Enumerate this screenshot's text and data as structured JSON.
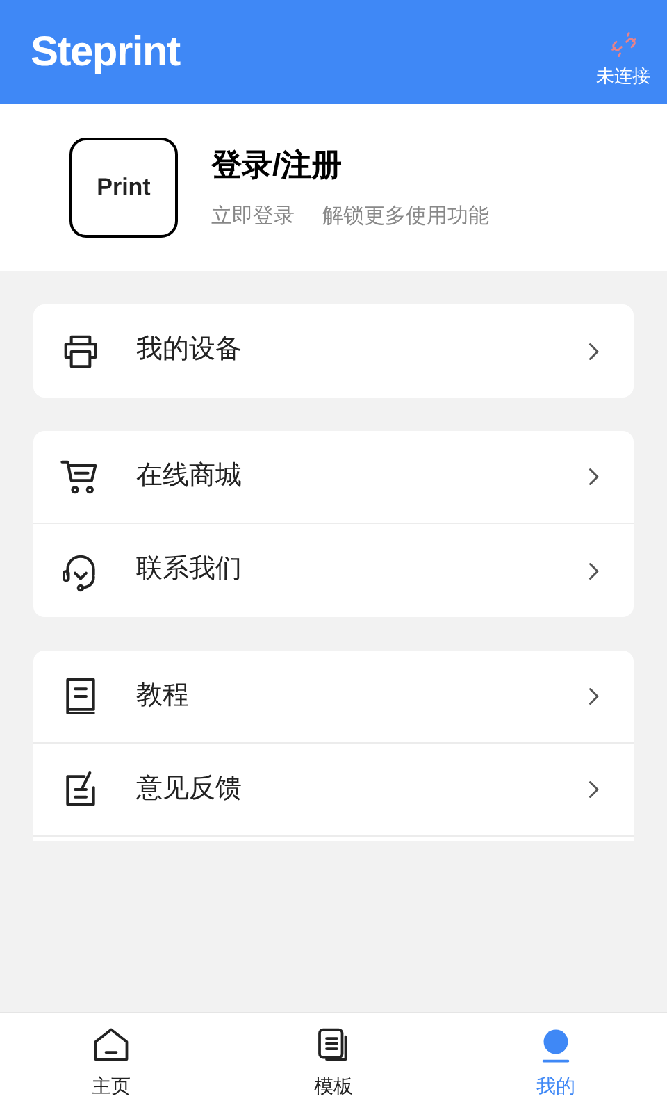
{
  "header": {
    "logo": "Steprint",
    "connection": {
      "label": "未连接",
      "connected": false
    }
  },
  "profile": {
    "avatar_text": "Print",
    "title": "登录/注册",
    "subtitle": "立即登录",
    "hint": "解锁更多使用功能"
  },
  "menu_groups": [
    {
      "items": [
        {
          "kind": "printer",
          "label": "我的设备"
        }
      ]
    },
    {
      "items": [
        {
          "kind": "cart",
          "label": "在线商城"
        },
        {
          "kind": "headset",
          "label": "联系我们"
        }
      ]
    },
    {
      "items": [
        {
          "kind": "book",
          "label": "教程"
        },
        {
          "kind": "feedback",
          "label": "意见反馈"
        }
      ]
    }
  ],
  "tabs": [
    {
      "kind": "home",
      "label": "主页",
      "selected": false
    },
    {
      "kind": "templates",
      "label": "模板",
      "selected": false
    },
    {
      "kind": "mine",
      "label": "我的",
      "selected": true
    }
  ]
}
